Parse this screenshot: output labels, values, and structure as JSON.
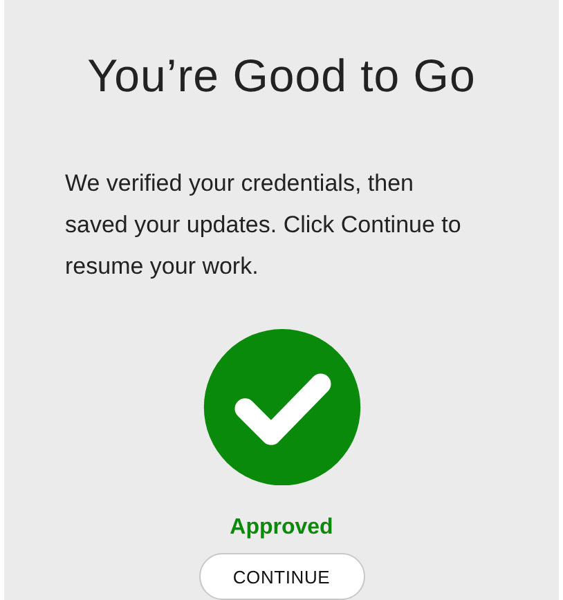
{
  "title": "You’re Good to Go",
  "message": "We verified your credentials, then saved your updates. Click Continue to resume your work.",
  "status": {
    "label": "Approved",
    "kind": "approved"
  },
  "buttons": [
    "CONTINUE"
  ]
}
